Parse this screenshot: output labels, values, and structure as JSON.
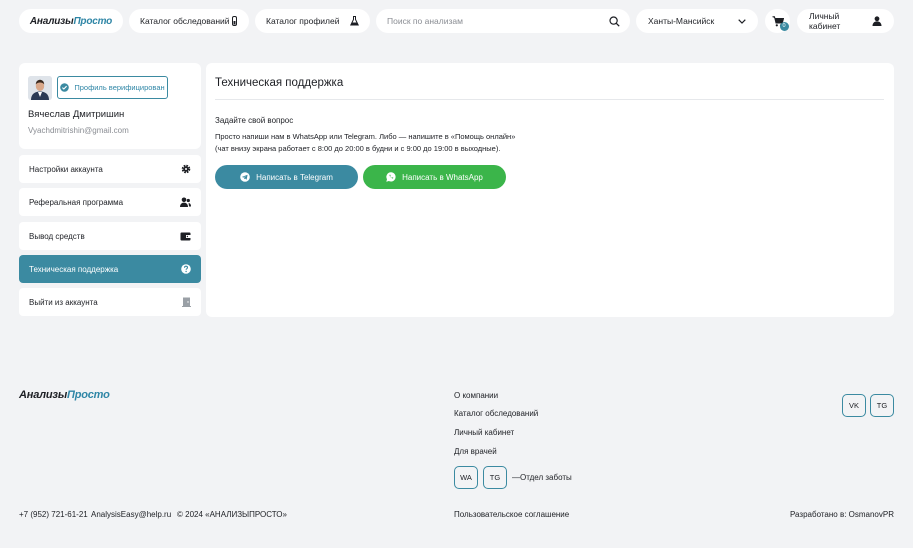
{
  "header": {
    "logo_part1": "Анализы",
    "logo_part2": "Просто",
    "catalog_exams": "Каталог обследований",
    "catalog_profiles": "Каталог профилей",
    "search_placeholder": "Поиск по анализам",
    "city": "Ханты-Мансийск",
    "cart_count": "0",
    "account": "Личный кабинет"
  },
  "profile": {
    "verified_label": "Профиль верифицирован",
    "name": "Вячеслав Дмитришин",
    "email": "Vyachdmitrishin@gmail.com"
  },
  "menu": [
    {
      "label": "Настройки аккаунта",
      "icon": "gear-icon"
    },
    {
      "label": "Реферальная программа",
      "icon": "users-icon"
    },
    {
      "label": "Вывод средств",
      "icon": "wallet-icon"
    },
    {
      "label": "Техническая поддержка",
      "icon": "help-icon"
    },
    {
      "label": "Выйти из аккаунта",
      "icon": "door-icon"
    }
  ],
  "support": {
    "title": "Техническая поддержка",
    "subtitle": "Задайте свой вопрос",
    "text_line1": "Просто напиши нам в WhatsApp или Telegram. Либо — напишите в «Помощь онлайн»",
    "text_line2": "(чат внизу экрана работает с 8:00 до 20:00 в будни и с 9:00 до 19:00 в выходные).",
    "telegram_button": "Написать в Telegram",
    "whatsapp_button": "Написать в WhatsApp"
  },
  "footer": {
    "logo_part1": "Анализы",
    "logo_part2": "Просто",
    "links": [
      "О компании",
      "Каталог обследований",
      "Личный кабинет",
      "Для врачей"
    ],
    "wa": "WA",
    "tg": "TG",
    "care_label": "—Отдел заботы",
    "vk": "VK",
    "tg_right": "TG",
    "phone": "+7 (952) 721-61-21",
    "email": "AnalysisEasy@help.ru",
    "copyright": "© 2024 «АНАЛИЗЫПРОСТО»",
    "agreement": "Пользовательское соглашение",
    "developer": "Разработано в: OsmanovPR"
  },
  "colors": {
    "accent": "#3b8aa1",
    "whatsapp": "#3bb54a",
    "background": "#f2f3f5"
  }
}
